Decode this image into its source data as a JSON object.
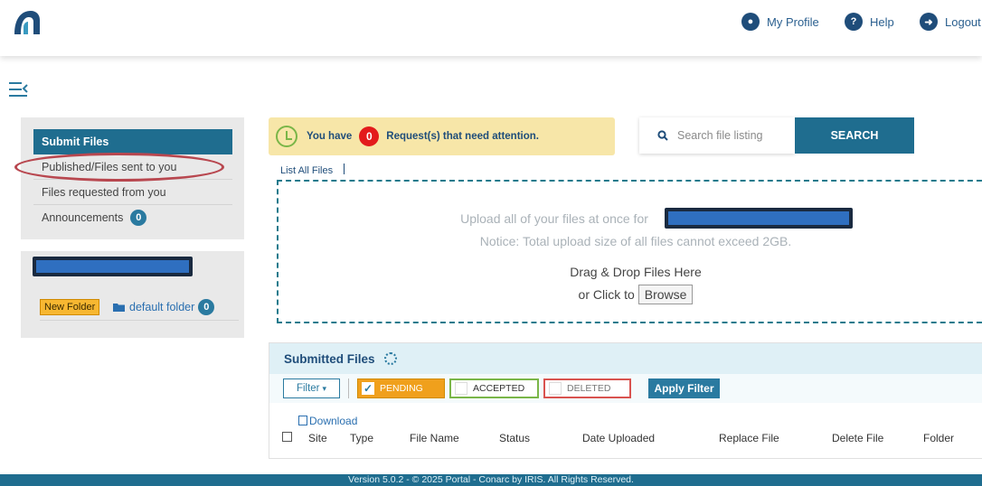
{
  "header": {
    "my_profile": "My Profile",
    "help": "Help",
    "logout": "Logout"
  },
  "sidebar": {
    "items": [
      {
        "label": "Submit Files"
      },
      {
        "label": "Published/Files sent to you"
      },
      {
        "label": "Files requested from you"
      },
      {
        "label": "Announcements",
        "count": "0"
      }
    ],
    "folder_panel": {
      "new_folder": "New Folder",
      "default_folder": "default folder",
      "default_folder_count": "0"
    }
  },
  "attention": {
    "prefix": "You have",
    "count": "0",
    "suffix": "Request(s) that need attention."
  },
  "search": {
    "placeholder": "Search file listing",
    "button": "SEARCH"
  },
  "list_all_files": "List All Files",
  "dropzone": {
    "upload_line": "Upload all of your files at once for",
    "notice": "Notice: Total upload size of all files cannot exceed 2GB.",
    "drag": "Drag & Drop Files Here",
    "click": "or Click to",
    "browse": "Browse"
  },
  "submitted": {
    "title": "Submitted Files",
    "filter": "Filter",
    "pending": "PENDING",
    "accepted": "ACCEPTED",
    "deleted": "DELETED",
    "apply": "Apply Filter",
    "download": "Download",
    "columns": [
      "Site",
      "Type",
      "File Name",
      "Status",
      "Date Uploaded",
      "Replace File",
      "Delete File",
      "Folder"
    ]
  },
  "footer": "Version 5.0.2 - © 2025 Portal - Conarc by IRIS. All Rights Reserved.",
  "colors": {
    "primary": "#1f6d8f",
    "attention_bg": "#f7e6a8",
    "pending": "#f0a01c",
    "accepted_border": "#7ab648",
    "deleted_border": "#d9534f",
    "annotation_oval": "#b8474f"
  }
}
